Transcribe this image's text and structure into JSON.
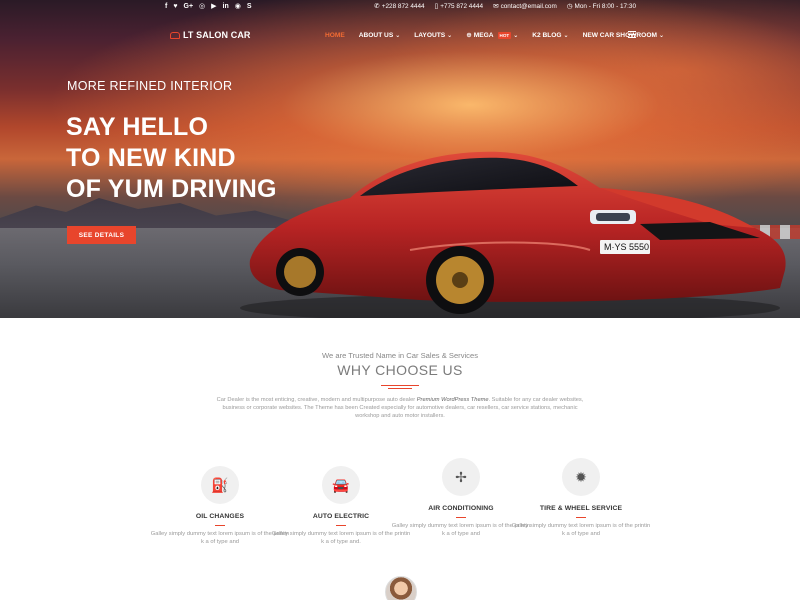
{
  "topbar": {
    "social": [
      "f",
      "♥",
      "G+",
      "◎",
      "▶",
      "in",
      "◉",
      "S"
    ],
    "phone1": "+228 872 4444",
    "phone2": "+775 872 4444",
    "email": "contact@email.com",
    "hours": "Mon - Fri 8:00 - 17:30"
  },
  "header": {
    "logo": "LT SALON CAR",
    "nav": [
      {
        "label": "HOME",
        "active": true
      },
      {
        "label": "ABOUT US"
      },
      {
        "label": "LAYOUTS"
      },
      {
        "label": "MEGA",
        "badge": "HOT"
      },
      {
        "label": "K2 BLOG"
      },
      {
        "label": "NEW CAR SHOWROOM"
      }
    ]
  },
  "hero": {
    "kicker": "MORE REFINED INTERIOR",
    "title_lines": [
      "SAY HELLO",
      "TO NEW KIND",
      "OF YUM DRIVING"
    ],
    "button": "SEE DETAILS",
    "plate": "M·YS 5550"
  },
  "why": {
    "subtitle": "We are Trusted Name in Car Sales & Services",
    "title": "WHY CHOOSE US",
    "desc_before": "Car Dealer is the most enticing, creative, modern and multipurpose auto dealer",
    "desc_em": "Premium WordPress Theme",
    "desc_after": ". Suitable for any car dealer websites, business or corporate websites. The Theme has been Created especially for automotive dealers, car resellers, car service stations, mechanic workshop and auto motor installers."
  },
  "services": [
    {
      "title": "OIL CHANGES",
      "icon": "oil-can-icon",
      "glyph": "⛽",
      "text": "Galley simply dummy text lorem ipsum is of the printin k a of type and"
    },
    {
      "title": "AUTO ELECTRIC",
      "icon": "car-icon",
      "glyph": "🚘",
      "text": "Galley simply dummy text lorem ipsum is of the printin k a of type and."
    },
    {
      "title": "AIR CONDITIONING",
      "icon": "fan-icon",
      "glyph": "✢",
      "text": "Galley simply dummy text lorem ipsum is of the printin k a of type and"
    },
    {
      "title": "TIRE & WHEEL SERVICE",
      "icon": "gear-icon",
      "glyph": "✹",
      "text": "Galley simply dummy text lorem ipsum is of the printin k a of type and"
    }
  ],
  "colors": {
    "accent": "#e8452c"
  }
}
